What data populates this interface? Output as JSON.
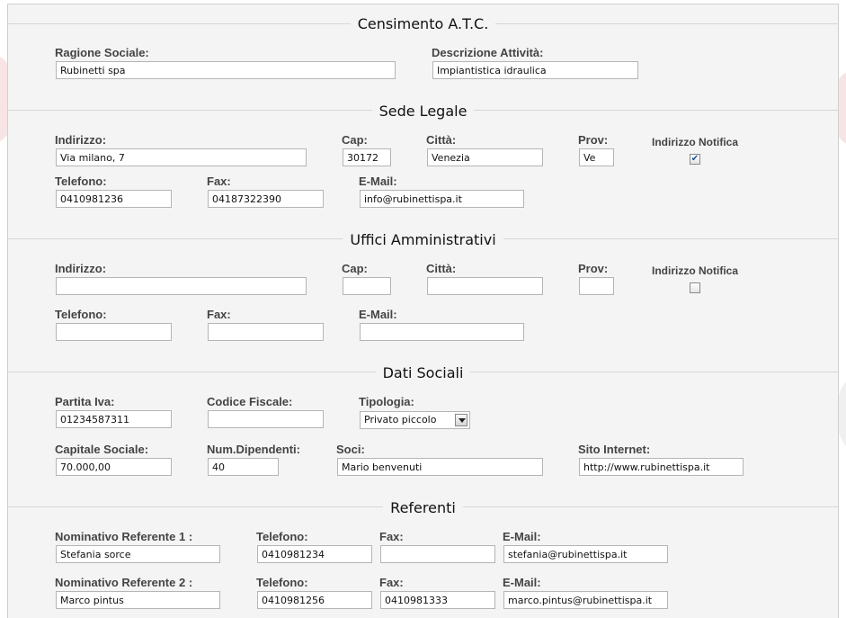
{
  "sections": {
    "censimento": "Censimento A.T.C.",
    "sede_legale": "Sede Legale",
    "uffici": "Uffici Amministrativi",
    "dati_sociali": "Dati Sociali",
    "referenti": "Referenti"
  },
  "censimento": {
    "ragione_sociale_label": "Ragione Sociale:",
    "ragione_sociale": "Rubinetti spa",
    "descrizione_label": "Descrizione Attività:",
    "descrizione": "Impiantistica idraulica"
  },
  "sede": {
    "indirizzo_label": "Indirizzo:",
    "indirizzo": "Via milano, 7",
    "cap_label": "Cap:",
    "cap": "30172",
    "citta_label": "Città:",
    "citta": "Venezia",
    "prov_label": "Prov:",
    "prov": "Ve",
    "notifica_label": "Indirizzo Notifica",
    "notifica_checked": true,
    "telefono_label": "Telefono:",
    "telefono": "0410981236",
    "fax_label": "Fax:",
    "fax": "04187322390",
    "email_label": "E-Mail:",
    "email": "info@rubinettispa.it"
  },
  "uffici": {
    "indirizzo_label": "Indirizzo:",
    "indirizzo": "",
    "cap_label": "Cap:",
    "cap": "",
    "citta_label": "Città:",
    "citta": "",
    "prov_label": "Prov:",
    "prov": "",
    "notifica_label": "Indirizzo Notifica",
    "notifica_checked": false,
    "telefono_label": "Telefono:",
    "telefono": "",
    "fax_label": "Fax:",
    "fax": "",
    "email_label": "E-Mail:",
    "email": ""
  },
  "dati": {
    "piva_label": "Partita Iva:",
    "piva": "01234587311",
    "cf_label": "Codice Fiscale:",
    "cf": "",
    "tipologia_label": "Tipologia:",
    "tipologia": "Privato piccolo",
    "capitale_label": "Capitale Sociale:",
    "capitale": "70.000,00",
    "dipendenti_label": "Num.Dipendenti:",
    "dipendenti": "40",
    "soci_label": "Soci:",
    "soci": "Mario benvenuti",
    "sito_label": "Sito Internet:",
    "sito": "http://www.rubinettispa.it"
  },
  "referenti": {
    "rows": [
      {
        "nome_label": "Nominativo Referente 1 :",
        "nome": "Stefania sorce",
        "tel_label": "Telefono:",
        "tel": "0410981234",
        "fax_label": "Fax:",
        "fax": "",
        "email_label": "E-Mail:",
        "email": "stefania@rubinettispa.it"
      },
      {
        "nome_label": "Nominativo Referente 2 :",
        "nome": "Marco pintus",
        "tel_label": "Telefono:",
        "tel": "0410981256",
        "fax_label": "Fax:",
        "fax": "0410981333",
        "email_label": "E-Mail:",
        "email": "marco.pintus@rubinettispa.it"
      }
    ]
  },
  "icons": {
    "checkbox_checked": "checkmark-icon",
    "dropdown": "chevron-down-icon"
  },
  "colors": {
    "panel": "#f4f4f4",
    "rule": "#d6d6d6",
    "label": "#444444"
  }
}
